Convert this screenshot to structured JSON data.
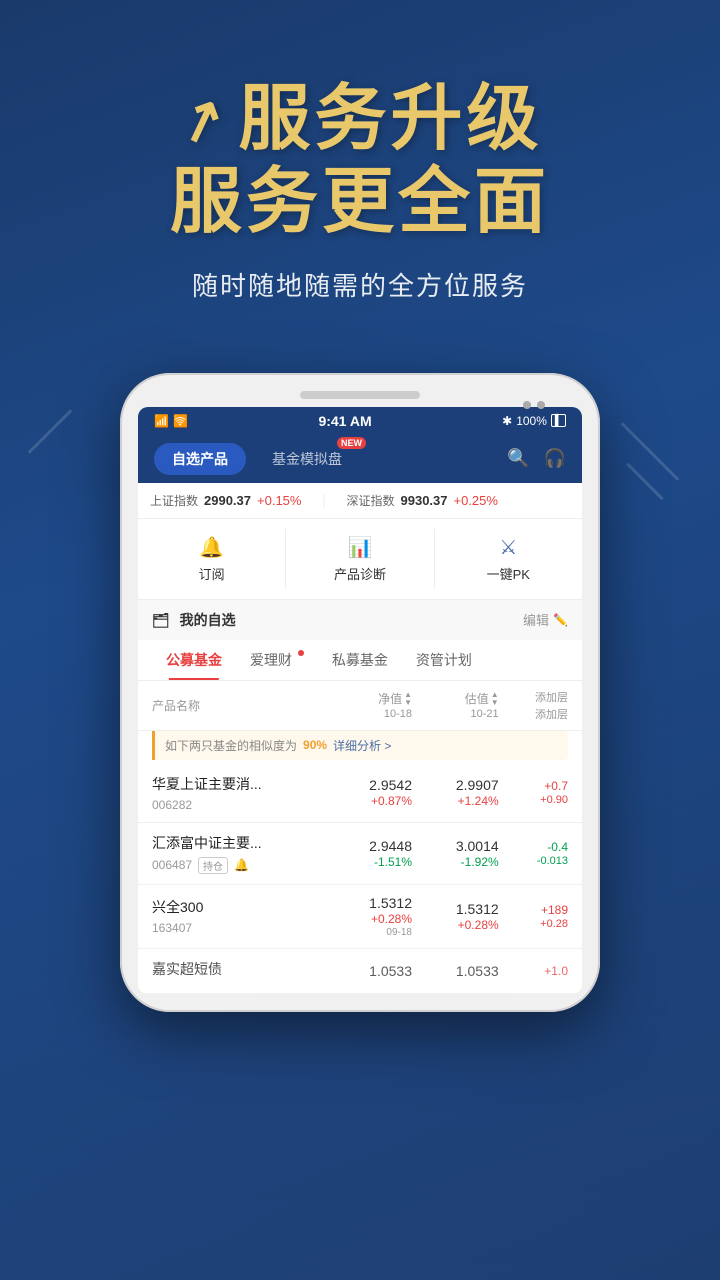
{
  "hero": {
    "icon": "↗",
    "title1": "服务升级",
    "title2": "服务更全面",
    "subtitle": "随时随地随需的全方位服务"
  },
  "statusBar": {
    "signal": "📶",
    "wifi": "🛜",
    "time": "9:41 AM",
    "bluetooth": "🔵",
    "battery": "100%"
  },
  "nav": {
    "tab1": "自选产品",
    "tab2": "基金模拟盘",
    "tab2Badge": "NEW",
    "searchIcon": "🔍",
    "headsetIcon": "🎧"
  },
  "ticker": {
    "item1Name": "上证指数",
    "item1Value": "2990.37",
    "item1Change": "+0.15%",
    "item2Name": "深证指数",
    "item2Value": "9930.37",
    "item2Change": "+0.25%"
  },
  "actions": [
    {
      "icon": "🔔",
      "label": "订阅"
    },
    {
      "icon": "📊",
      "label": "产品诊断"
    },
    {
      "icon": "⚔",
      "label": "一键PK"
    }
  ],
  "section": {
    "title": "我的自选",
    "edit": "编辑"
  },
  "fundTabs": [
    {
      "label": "公募基金",
      "active": true
    },
    {
      "label": "爱理财",
      "dot": true
    },
    {
      "label": "私募基金"
    },
    {
      "label": "资管计划"
    }
  ],
  "tableHeader": {
    "name": "产品名称",
    "nav": "净值",
    "navDate": "10-18",
    "est": "估值",
    "estDate": "10-21",
    "add": "添加层",
    "addSub": "添加层"
  },
  "similarity": {
    "text1": "如下两只基金的相似度为",
    "pct": "90%",
    "link": "详细分析 >"
  },
  "funds": [
    {
      "name": "华夏上证主要消...",
      "code": "006282",
      "navValue": "2.9542",
      "navChange": "+0.87%",
      "estValue": "2.9907",
      "estChange": "+1.24%",
      "addValue": "+0.7",
      "addSub": "+0.90",
      "hasTag": false,
      "hasBell": false
    },
    {
      "name": "汇添富中证主要...",
      "code": "006487",
      "navValue": "2.9448",
      "navChange": "-1.51%",
      "estValue": "3.0014",
      "estChange": "-1.92%",
      "addValue": "-0.4",
      "addSub": "-0.013",
      "hasTag": true,
      "tagLabel": "持仓",
      "hasBell": true
    },
    {
      "name": "兴全300",
      "code": "163407",
      "navValue": "1.5312",
      "navChange": "+0.28%",
      "navDate": "09-18",
      "estValue": "1.5312",
      "estChange": "+0.28%",
      "addValue": "+189",
      "addSub": "+0.28",
      "hasTag": false,
      "hasBell": false
    },
    {
      "name": "嘉实超短债",
      "code": "",
      "navValue": "1.0533",
      "navChange": "",
      "estValue": "1.0533",
      "estChange": "",
      "addValue": "+1.0",
      "addSub": "",
      "hasTag": false,
      "hasBell": false
    }
  ]
}
